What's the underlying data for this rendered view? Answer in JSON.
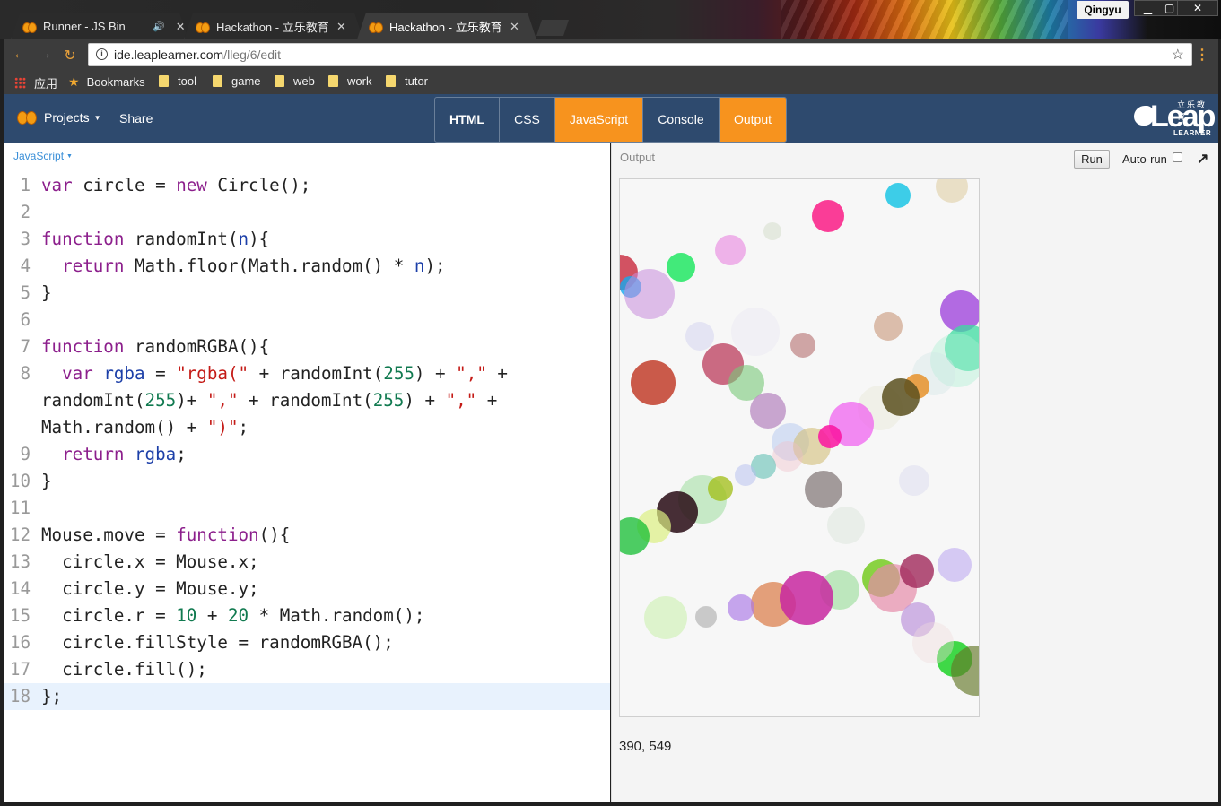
{
  "browser": {
    "tabs": [
      {
        "label": "Runner - JS Bin",
        "audio": true,
        "active": false
      },
      {
        "label": "Hackathon - 立乐教育",
        "audio": false,
        "active": false
      },
      {
        "label": "Hackathon - 立乐教育",
        "audio": false,
        "active": true
      }
    ],
    "user": "Qingyu",
    "url_host": "ide.leaplearner.com",
    "url_path": "/lleg/6/edit",
    "bookmarks": [
      {
        "label": "应用",
        "icon": "apps-grid-icon"
      },
      {
        "label": "Bookmarks",
        "icon": "star-icon"
      },
      {
        "label": "tool",
        "icon": "folder-icon"
      },
      {
        "label": "game",
        "icon": "folder-icon"
      },
      {
        "label": "web",
        "icon": "folder-icon"
      },
      {
        "label": "work",
        "icon": "folder-icon"
      },
      {
        "label": "tutor",
        "icon": "folder-icon"
      }
    ]
  },
  "appbar": {
    "projects": "Projects",
    "share": "Share",
    "panels": [
      {
        "label": "HTML",
        "active": false,
        "bold": true
      },
      {
        "label": "CSS",
        "active": false,
        "bold": false
      },
      {
        "label": "JavaScript",
        "active": true,
        "bold": false
      },
      {
        "label": "Console",
        "active": false,
        "bold": false
      },
      {
        "label": "Output",
        "active": true,
        "bold": false
      }
    ],
    "logo": {
      "word": "Leap",
      "cn": "立乐教育",
      "sub": "LEARNER"
    }
  },
  "editor": {
    "language": "JavaScript",
    "active_line": "18"
  },
  "output": {
    "label": "Output",
    "run": "Run",
    "autorun": "Auto-run",
    "coords": "390, 549"
  },
  "colors": {
    "accent_orange": "#f7931e",
    "bar_blue": "#2e4a6e",
    "link_blue": "#3a8fd8"
  }
}
